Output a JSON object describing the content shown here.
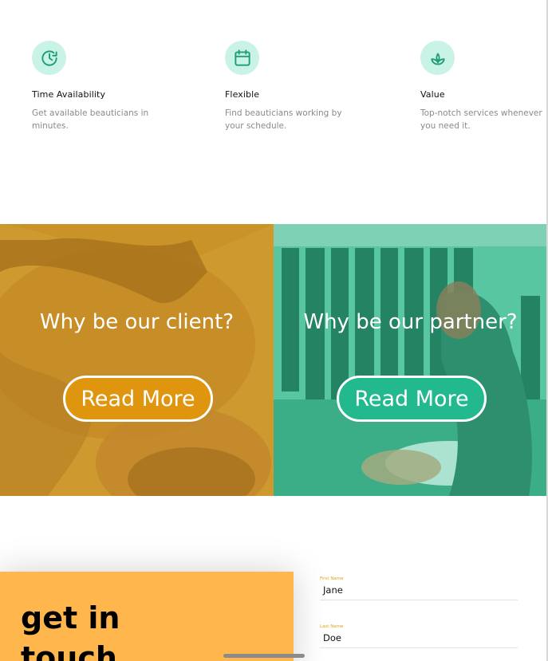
{
  "features": [
    {
      "icon": "clock-icon",
      "title": "Time Availability",
      "desc": "Get available beauticians in minutes."
    },
    {
      "icon": "calendar-icon",
      "title": "Flexible",
      "desc": "Find beauticians working by your schedule."
    },
    {
      "icon": "leaf-icon",
      "title": "Value",
      "desc": "Top-notch services whenever you need it."
    }
  ],
  "panels": {
    "client": {
      "title": "Why be our client?",
      "button": "Read More",
      "button_color": "#e0950f"
    },
    "partner": {
      "title": "Why be our partner?",
      "button": "Read More",
      "button_color": "#22b98e"
    }
  },
  "contact": {
    "heading_line1": "get in",
    "heading_line2": "touch",
    "first_name_label": "First Name",
    "first_name_value": "Jane",
    "last_name_label": "Last Name",
    "last_name_value": "Doe"
  },
  "colors": {
    "accent_green": "#30c9a0",
    "accent_orange": "#ffb74d"
  }
}
